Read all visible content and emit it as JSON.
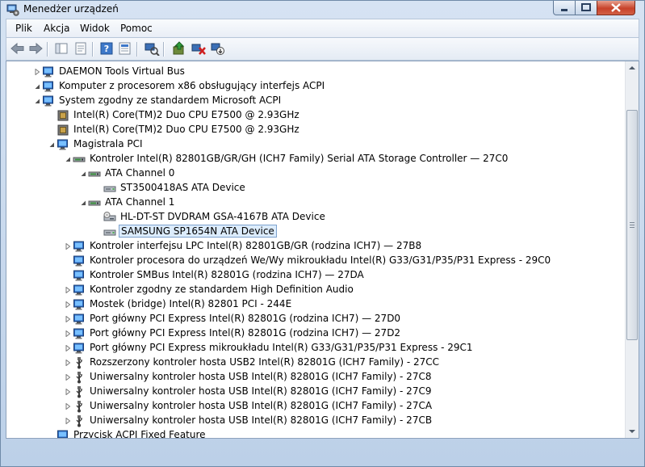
{
  "window": {
    "title": "Menedżer urządzeń",
    "icon": "device-manager-icon"
  },
  "menu": [
    "Plik",
    "Akcja",
    "Widok",
    "Pomoc"
  ],
  "toolbar": [
    {
      "name": "back-button",
      "icon": "arrow-left-icon"
    },
    {
      "name": "forward-button",
      "icon": "arrow-right-icon"
    },
    {
      "name": "show-hide-console-tree-button",
      "icon": "console-tree-icon"
    },
    {
      "name": "properties-button",
      "icon": "properties-icon"
    },
    {
      "name": "help-button",
      "icon": "help-icon"
    },
    {
      "name": "console-button",
      "icon": "console-icon"
    },
    {
      "name": "scan-hardware-button",
      "icon": "scan-hardware-icon"
    },
    {
      "name": "update-driver-button",
      "icon": "update-driver-icon"
    },
    {
      "name": "uninstall-button",
      "icon": "uninstall-icon"
    },
    {
      "name": "disable-button",
      "icon": "disable-icon"
    }
  ],
  "tree": [
    {
      "level": 1,
      "expander": "collapsed",
      "icon": "monitor-icon",
      "label": "DAEMON Tools Virtual Bus"
    },
    {
      "level": 1,
      "expander": "expanded",
      "icon": "monitor-icon",
      "label": "Komputer z procesorem x86 obsługujący interfejs ACPI"
    },
    {
      "level": 2,
      "expander": "expanded",
      "icon": "monitor-icon",
      "label": "System zgodny ze standardem Microsoft ACPI"
    },
    {
      "level": 3,
      "expander": "none",
      "icon": "cpu-icon",
      "label": "Intel(R) Core(TM)2 Duo CPU     E7500  @ 2.93GHz"
    },
    {
      "level": 3,
      "expander": "none",
      "icon": "cpu-icon",
      "label": "Intel(R) Core(TM)2 Duo CPU     E7500  @ 2.93GHz"
    },
    {
      "level": 3,
      "expander": "expanded",
      "icon": "monitor-icon",
      "label": "Magistrala PCI"
    },
    {
      "level": 4,
      "expander": "expanded",
      "icon": "ide-controller-icon",
      "label": "Kontroler Intel(R) 82801GB/GR/GH (ICH7 Family) Serial ATA Storage Controller — 27C0"
    },
    {
      "level": 5,
      "expander": "expanded",
      "icon": "ide-channel-icon",
      "label": "ATA Channel 0"
    },
    {
      "level": 6,
      "expander": "none",
      "icon": "hard-disk-icon",
      "label": "ST3500418AS ATA Device"
    },
    {
      "level": 5,
      "expander": "expanded",
      "icon": "ide-channel-icon",
      "label": "ATA Channel 1"
    },
    {
      "level": 6,
      "expander": "none",
      "icon": "dvd-drive-icon",
      "label": "HL-DT-ST DVDRAM GSA-4167B ATA Device"
    },
    {
      "level": 6,
      "expander": "none",
      "icon": "hard-disk-icon",
      "label": "SAMSUNG SP1654N ATA Device",
      "selected": true
    },
    {
      "level": 4,
      "expander": "collapsed",
      "icon": "monitor-icon",
      "label": "Kontroler interfejsu LPC Intel(R) 82801GB/GR (rodzina ICH7) — 27B8"
    },
    {
      "level": 4,
      "expander": "none",
      "icon": "monitor-icon",
      "label": "Kontroler procesora do urządzeń We/Wy mikroukładu  Intel(R) G33/G31/P35/P31 Express - 29C0"
    },
    {
      "level": 4,
      "expander": "none",
      "icon": "monitor-icon",
      "label": "Kontroler SMBus Intel(R) 82801G (rodzina ICH7) — 27DA"
    },
    {
      "level": 4,
      "expander": "collapsed",
      "icon": "monitor-icon",
      "label": "Kontroler zgodny ze standardem High Definition Audio"
    },
    {
      "level": 4,
      "expander": "collapsed",
      "icon": "monitor-icon",
      "label": "Mostek (bridge) Intel(R) 82801 PCI - 244E"
    },
    {
      "level": 4,
      "expander": "collapsed",
      "icon": "monitor-icon",
      "label": "Port główny PCI Express Intel(R) 82801G (rodzina ICH7) — 27D0"
    },
    {
      "level": 4,
      "expander": "collapsed",
      "icon": "monitor-icon",
      "label": "Port główny PCI Express Intel(R) 82801G (rodzina ICH7) — 27D2"
    },
    {
      "level": 4,
      "expander": "collapsed",
      "icon": "monitor-icon",
      "label": "Port główny PCI Express mikroukładu Intel(R) G33/G31/P35/P31 Express - 29C1"
    },
    {
      "level": 4,
      "expander": "collapsed",
      "icon": "usb-icon",
      "label": "Rozszerzony kontroler hosta USB2 Intel(R) 82801G (ICH7 Family) - 27CC"
    },
    {
      "level": 4,
      "expander": "collapsed",
      "icon": "usb-icon",
      "label": "Uniwersalny kontroler hosta USB Intel(R) 82801G (ICH7 Family) - 27C8"
    },
    {
      "level": 4,
      "expander": "collapsed",
      "icon": "usb-icon",
      "label": "Uniwersalny kontroler hosta USB Intel(R) 82801G (ICH7 Family) - 27C9"
    },
    {
      "level": 4,
      "expander": "collapsed",
      "icon": "usb-icon",
      "label": "Uniwersalny kontroler hosta USB Intel(R) 82801G (ICH7 Family) - 27CA"
    },
    {
      "level": 4,
      "expander": "collapsed",
      "icon": "usb-icon",
      "label": "Uniwersalny kontroler hosta USB Intel(R) 82801G (ICH7 Family) - 27CB"
    },
    {
      "level": 3,
      "expander": "none",
      "icon": "monitor-icon",
      "label": "Przycisk ACPI Fixed Feature"
    }
  ],
  "colors": {
    "selection_bg": "#dcecfc",
    "selection_border": "#7da2ce",
    "window_frame": "#c9d9ec"
  }
}
